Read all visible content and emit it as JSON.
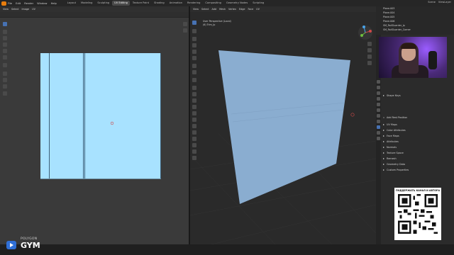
{
  "topbar": {
    "menus": [
      "File",
      "Edit",
      "Render",
      "Window",
      "Help"
    ],
    "workspaces": [
      "Layout",
      "Modeling",
      "Sculpting",
      "UV Editing",
      "Texture Paint",
      "Shading",
      "Animation",
      "Rendering",
      "Compositing",
      "Geometry Nodes",
      "Scripting"
    ],
    "active_workspace": "UV Editing",
    "scene_label": "Scene",
    "view_layer_label": "ViewLayer"
  },
  "uv_editor": {
    "header_items": [
      "View",
      "Select",
      "Image",
      "UV"
    ]
  },
  "viewport": {
    "header_items": [
      "View",
      "Select",
      "Add",
      "Mesh",
      "Vertex",
      "Edge",
      "Face",
      "UV"
    ],
    "info_line1": "User Perspective (Local)",
    "info_line2": "(6) Trim_lp"
  },
  "outliner": {
    "rows": [
      "Plane.003",
      "Plane.004",
      "Plane.005",
      "Plane.006",
      "SM_RailGuarder_lp",
      "SM_RailGuarder_Corner"
    ]
  },
  "properties": {
    "items": [
      "Shape Keys",
      "Add Rest Position",
      "UV Maps",
      "Color Attributes",
      "Face Maps",
      "Attributes",
      "Normals",
      "Texture Space",
      "Remesh",
      "Geometry Data",
      "Custom Properties"
    ]
  },
  "qr": {
    "title": "ПОДДЕРЖАТЬ КАНАЛ И АВТОРА"
  },
  "brand": {
    "top": "POLYGON",
    "big": "GYM"
  }
}
